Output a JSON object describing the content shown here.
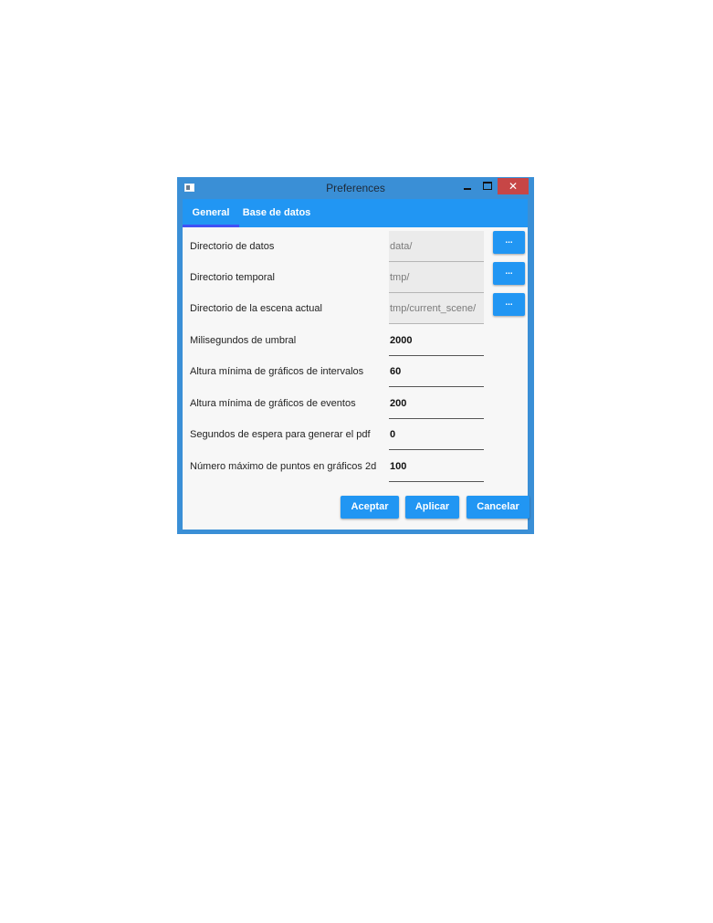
{
  "window": {
    "title": "Preferences",
    "minimize": "–",
    "close": "✕"
  },
  "tabs": [
    {
      "label": "General",
      "selected": true
    },
    {
      "label": "Base de datos",
      "selected": false
    }
  ],
  "form": {
    "data_dir": {
      "label": "Directorio de datos",
      "value": "data/",
      "button": "..."
    },
    "temp_dir": {
      "label": "Directorio temporal",
      "value": "tmp/",
      "button": "..."
    },
    "scene_dir": {
      "label": "Directorio de la escena actual",
      "value": "tmp/current_scene/",
      "button": "..."
    },
    "threshold_ms": {
      "label": "Milisegundos de umbral",
      "value": "2000"
    },
    "min_interval_height": {
      "label": "Altura mínima de gráficos de intervalos",
      "value": "60"
    },
    "min_event_height": {
      "label": "Altura mínima de gráficos de eventos",
      "value": "200"
    },
    "pdf_wait": {
      "label": "Segundos de espera para generar el pdf",
      "value": "0"
    },
    "max_points_2d": {
      "label": "Número máximo de puntos en gráficos 2d",
      "value": "100"
    }
  },
  "actions": {
    "accept": "Aceptar",
    "apply": "Aplicar",
    "cancel": "Cancelar"
  },
  "colors": {
    "accent": "#2196f3",
    "tab_indicator": "#3f51f5",
    "close": "#c74646"
  }
}
